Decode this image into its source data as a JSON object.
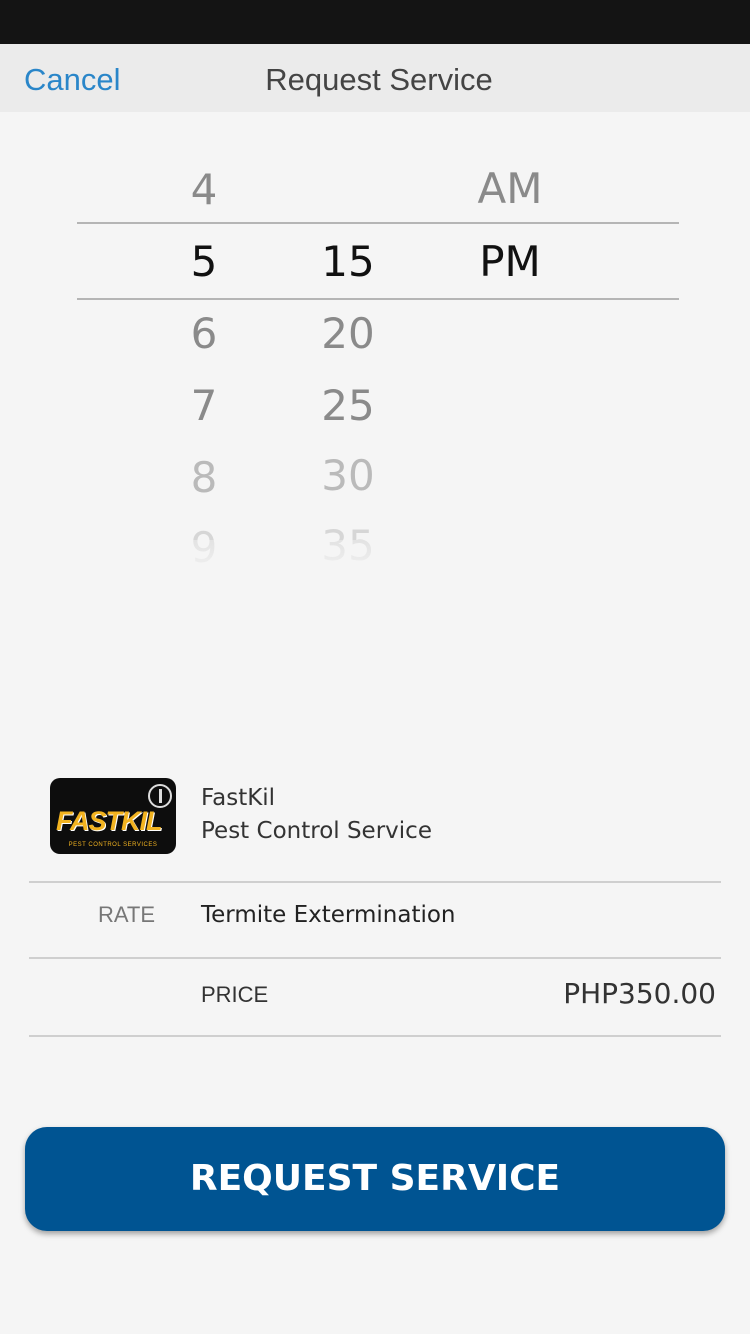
{
  "nav": {
    "cancel_label": "Cancel",
    "title": "Request Service"
  },
  "time_picker": {
    "hours": [
      "4",
      "5",
      "6",
      "7",
      "8",
      "9"
    ],
    "minutes": [
      "15",
      "20",
      "25",
      "30",
      "35"
    ],
    "periods": [
      "AM",
      "PM"
    ],
    "selected": {
      "hour": "5",
      "minute": "15",
      "period": "PM"
    }
  },
  "provider": {
    "logo_text": "FASTKIL",
    "logo_subtext": "PEST CONTROL SERVICES",
    "name": "FastKil",
    "type": "Pest Control Service"
  },
  "details": {
    "rate_label": "RATE",
    "rate_value": "Termite Extermination",
    "price_label": "PRICE",
    "price_value": "PHP350.00"
  },
  "action": {
    "request_label": "REQUEST SERVICE"
  },
  "colors": {
    "accent": "#2a86c9",
    "button": "#005492"
  }
}
